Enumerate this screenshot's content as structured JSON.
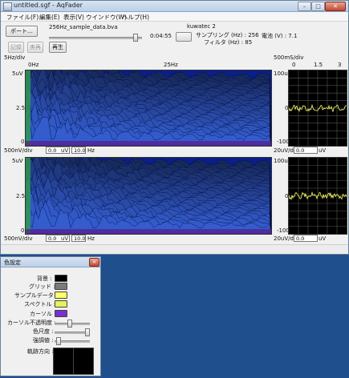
{
  "window": {
    "title": "untitled.sgf - AqFader",
    "minimize": "–",
    "maximize": "□",
    "close": "✕"
  },
  "menu": [
    "ファイル(F)",
    "編集(E)",
    "表示(V)",
    "ウインドウ(W)",
    "ヘルプ(H)"
  ],
  "toolbar": {
    "port_button": "ポート...",
    "filename": "256Hz_sample_data.bva",
    "time": "0:04:55",
    "device": "kuwatec 2",
    "sampling": "サンプリング (Hz) : 256",
    "filter": "フィルタ (Hz) : 85",
    "voltage": "電池 (V) : 7.1",
    "record_button": "記録",
    "realtime_button": "実再",
    "play_button": "再生",
    "seek_fraction": 0.93
  },
  "spectrum": {
    "scale_label": "5Hz/div",
    "tick_0": "0Hz",
    "tick_25": "25Hz",
    "channel1": {
      "y_top": "5uV",
      "y_mid": "2.5",
      "y_bottom": "0",
      "uv_div": "500nV/div",
      "field1": "0.0",
      "unit1": "uV",
      "field2": "10.0",
      "unit2": "Hz"
    },
    "channel2": {
      "y_top": "5uV",
      "y_mid": "2.5",
      "y_bottom": "0",
      "uv_div": "500nV/div",
      "field1": "0.0",
      "unit1": "uV",
      "field2": "10.0",
      "unit2": "Hz"
    }
  },
  "wave": {
    "time_div": "500mS/div",
    "tick_0": "0",
    "tick_15": "1.5",
    "tick_3": "3",
    "channel1": {
      "y_top": "100uV",
      "y_mid": "0",
      "y_bottom": "-100",
      "uv_div": "20uV/div",
      "field1": "0.0",
      "unit1": "uV"
    },
    "channel2": {
      "y_top": "100uV",
      "y_mid": "0",
      "y_bottom": "-100",
      "uv_div": "20uV/div",
      "field1": "0.0",
      "unit1": "uV"
    }
  },
  "color_settings": {
    "title": "色設定",
    "close": "✕",
    "items": [
      {
        "label": "背景 :",
        "color": "#000000"
      },
      {
        "label": "グリッド :",
        "color": "#7a7a7a"
      },
      {
        "label": "サンプルデータ :",
        "color": "#ffff66"
      },
      {
        "label": "スペクトル :",
        "color": "#e8f05a"
      },
      {
        "label": "カーソル :",
        "color": "#7a2fd0"
      }
    ],
    "cursor_opacity_label": "カーソル不透明度 :",
    "color_depth_label": "色尺度 :",
    "emphasis_label": "強調値 :",
    "direction_label": "軌跡方向 :"
  }
}
